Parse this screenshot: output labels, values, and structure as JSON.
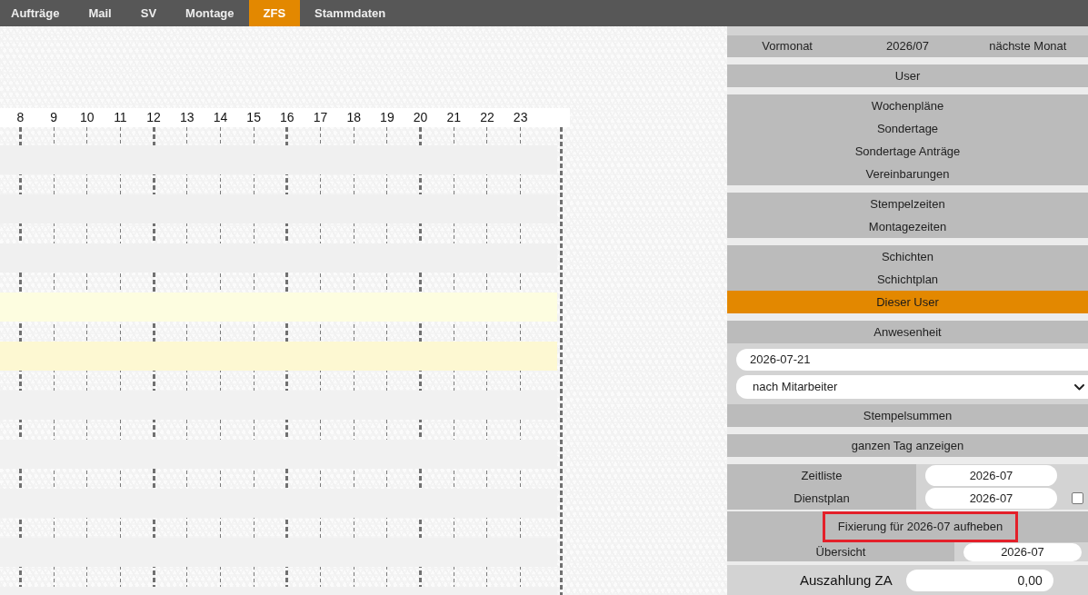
{
  "top_nav": {
    "tabs": [
      {
        "label": "Aufträge",
        "selected": false
      },
      {
        "label": "Mail",
        "selected": false
      },
      {
        "label": "SV",
        "selected": false
      },
      {
        "label": "Montage",
        "selected": false
      },
      {
        "label": "ZFS",
        "selected": true
      },
      {
        "label": "Stammdaten",
        "selected": false
      }
    ]
  },
  "timeline": {
    "hours": [
      {
        "label": "8",
        "major": true
      },
      {
        "label": "9",
        "major": false
      },
      {
        "label": "10",
        "major": false
      },
      {
        "label": "11",
        "major": false
      },
      {
        "label": "12",
        "major": true
      },
      {
        "label": "13",
        "major": false
      },
      {
        "label": "14",
        "major": false
      },
      {
        "label": "15",
        "major": false
      },
      {
        "label": "16",
        "major": true
      },
      {
        "label": "17",
        "major": false
      },
      {
        "label": "18",
        "major": false
      },
      {
        "label": "19",
        "major": false
      },
      {
        "label": "20",
        "major": true
      },
      {
        "label": "21",
        "major": false
      },
      {
        "label": "22",
        "major": false
      },
      {
        "label": "23",
        "major": false
      }
    ],
    "rows": [
      {
        "color": "#f0f0f0"
      },
      {
        "color": "#f0f0f0"
      },
      {
        "color": "#f0f0f0"
      },
      {
        "color": "#fdfde0"
      },
      {
        "color": "#fdf8d2"
      },
      {
        "color": "#f1f1f1"
      },
      {
        "color": "#f1f1f1"
      },
      {
        "color": "#f1f1f1"
      },
      {
        "color": "#f1f1f1"
      },
      {
        "color": "#f1f1f1"
      }
    ]
  },
  "side_panel": {
    "month_nav": {
      "previous": "Vormonat",
      "current": "2026/07",
      "next": "nächste Monat"
    },
    "menu_groups": [
      {
        "items": [
          {
            "label": "User",
            "selected": false
          }
        ]
      },
      {
        "items": [
          {
            "label": "Wochenpläne",
            "selected": false
          },
          {
            "label": "Sondertage",
            "selected": false
          },
          {
            "label": "Sondertage Anträge",
            "selected": false
          },
          {
            "label": "Vereinbarungen",
            "selected": false
          }
        ]
      },
      {
        "items": [
          {
            "label": "Stempelzeiten",
            "selected": false
          },
          {
            "label": "Montagezeiten",
            "selected": false
          }
        ]
      },
      {
        "items": [
          {
            "label": "Schichten",
            "selected": false
          },
          {
            "label": "Schichtplan",
            "selected": false
          },
          {
            "label": "Dieser User",
            "selected": true
          }
        ]
      },
      {
        "items": [
          {
            "label": "Anwesenheit",
            "selected": false
          }
        ]
      }
    ],
    "attendance": {
      "date": "2026-07-21",
      "grouping": "nach Mitarbeiter"
    },
    "actions": [
      "Stempelsummen",
      "ganzen Tag anzeigen"
    ],
    "month_reports": [
      {
        "kind": "month",
        "label": "Zeitliste",
        "month": "2026-07"
      },
      {
        "kind": "month_check",
        "label": "Dienstplan",
        "month": "2026-07",
        "checked": false
      }
    ],
    "unlock_button": {
      "label": "Fixierung für 2026-07 aufheben",
      "highlighted": true
    },
    "overview": {
      "label": "Übersicht",
      "month": "2026-07"
    },
    "payout": {
      "label": "Auszahlung ZA",
      "value": "0,00"
    }
  }
}
